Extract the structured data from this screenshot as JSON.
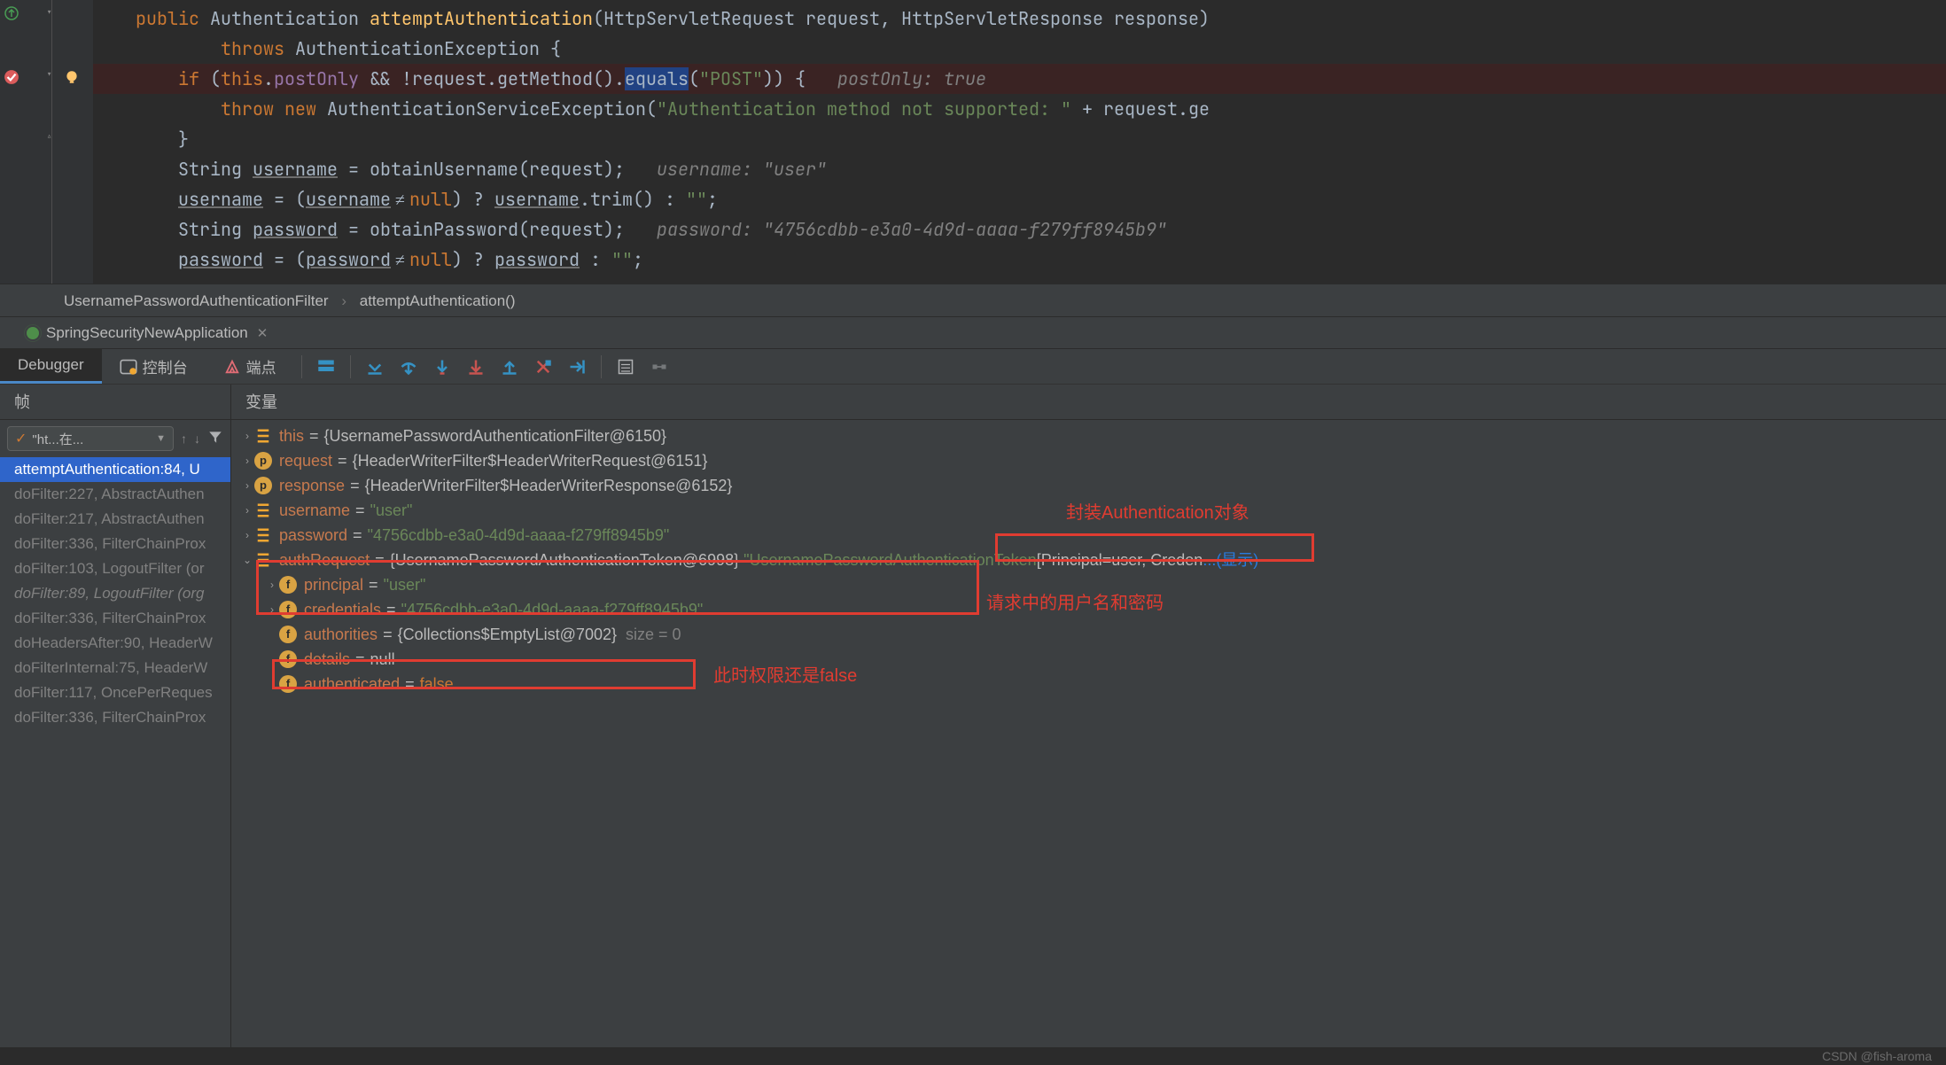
{
  "code": {
    "sig_kw": "public",
    "sig_type": "Authentication",
    "sig_method": "attemptAuthentication",
    "sig_args": "(HttpServletRequest request, HttpServletResponse response)",
    "throws_kw": "throws",
    "throws_type": "AuthenticationException {",
    "if_kw": "if",
    "this_kw": "this",
    "postOnly": "postOnly",
    "rest_if": " && !request.getMethod().equals(",
    "eq_target": "equals",
    "post_str": "\"POST\"",
    "if_close": ")) {",
    "inline1a": "postOnly:",
    "inline1b": "true",
    "throw_kw": "throw",
    "new_kw": "new",
    "exc_type": "AuthenticationServiceException(",
    "exc_msg": "\"Authentication method not supported: \"",
    "exc_tail": " + request.ge",
    "close_brace": "}",
    "s_string": "String ",
    "var_username": "username",
    "eq_obtU": " = obtainUsername(request);",
    "inline2a": "username:",
    "inline2b": "\"user\"",
    "tern_open": " = (",
    "neq": " ≠ ",
    "null_kw": "null",
    "tern_mid": ") ? ",
    "trim_call": ".trim() : ",
    "empty_str": "\"\"",
    "semi": ";",
    "var_password": "password",
    "eq_obtP": " = obtainPassword(request);",
    "inline3a": "password:",
    "inline3b": "\"4756cdbb-e3a0-4d9d-aaaa-f279ff8945b9\"",
    "tern_pwd": " : "
  },
  "breadcrumb": {
    "c1": "UsernamePasswordAuthenticationFilter",
    "c2": "attemptAuthentication()"
  },
  "run": {
    "config_name": "SpringSecurityNewApplication"
  },
  "dbg": {
    "tab_debugger": "Debugger",
    "tab_console": "控制台",
    "tab_threads": "端点"
  },
  "panes": {
    "frames_header": "帧",
    "vars_header": "变量"
  },
  "frames": {
    "combo": "\"ht...在...",
    "list": [
      "attemptAuthentication:84, U",
      "doFilter:227, AbstractAuthen",
      "doFilter:217, AbstractAuthen",
      "doFilter:336, FilterChainProx",
      "doFilter:103, LogoutFilter (or",
      "doFilter:89, LogoutFilter (org",
      "doFilter:336, FilterChainProx",
      "doHeadersAfter:90, HeaderW",
      "doFilterInternal:75, HeaderW",
      "doFilter:117, OncePerReques",
      "doFilter:336, FilterChainProx"
    ]
  },
  "vars": {
    "this_name": "this",
    "this_val": "{UsernamePasswordAuthenticationFilter@6150}",
    "req_name": "request",
    "req_val": "{HeaderWriterFilter$HeaderWriterRequest@6151}",
    "resp_name": "response",
    "resp_val": "{HeaderWriterFilter$HeaderWriterResponse@6152}",
    "un_name": "username",
    "un_val": "\"user\"",
    "pw_name": "password",
    "pw_val": "\"4756cdbb-e3a0-4d9d-aaaa-f279ff8945b9\"",
    "ar_name": "authRequest",
    "ar_val": "{UsernamePasswordAuthenticationToken@6998}",
    "ar_str_a": "\"UsernamePasswordAuthenticationToken ",
    "ar_str_b": "[Principal=user, Creden",
    "show": "...(显示)",
    "pr_name": "principal",
    "pr_val": "\"user\"",
    "cr_name": "credentials",
    "cr_val": "\"4756cdbb-e3a0-4d9d-aaaa-f279ff8945b9\"",
    "au_name": "authorities",
    "au_val": "{Collections$EmptyList@7002}",
    "au_size_lbl": "size = ",
    "au_size": "0",
    "de_name": "details",
    "de_val": "null",
    "an_name": "authenticated",
    "an_val": "false"
  },
  "notes": {
    "n1": "封装Authentication对象",
    "n2": "请求中的用户名和密码",
    "n3": "此时权限还是false"
  },
  "watermark": "CSDN @fish-aroma"
}
